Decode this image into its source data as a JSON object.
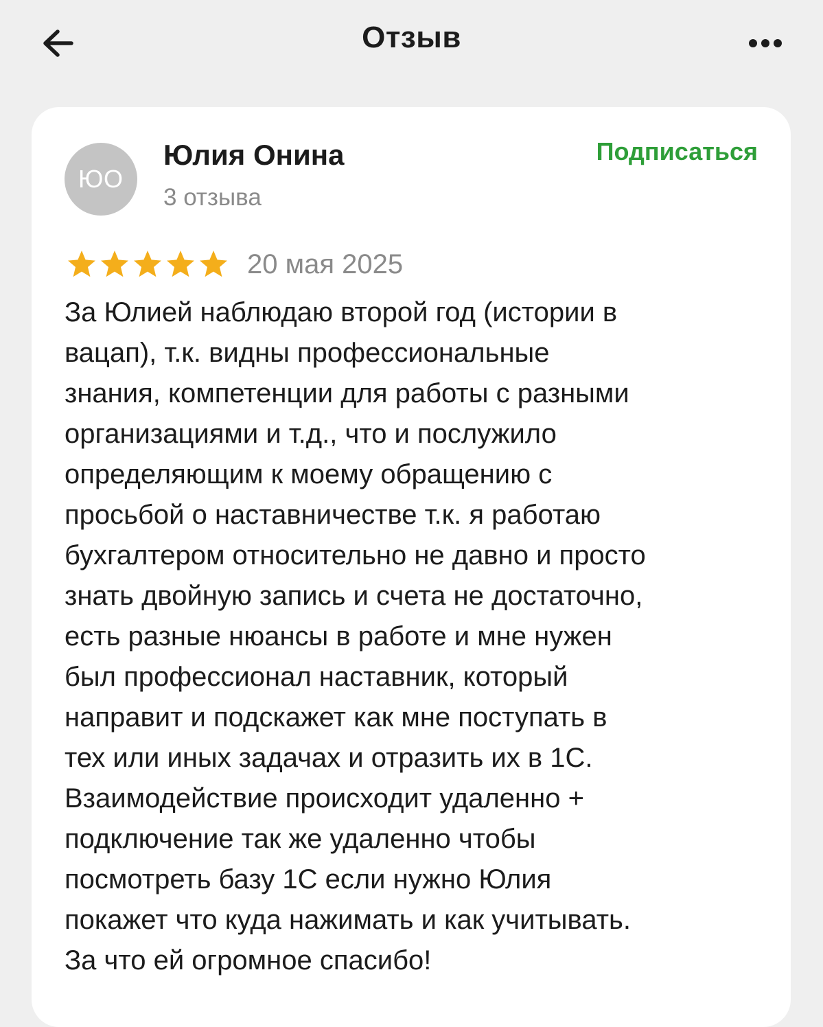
{
  "header": {
    "title": "Отзыв",
    "back_icon": "arrow-left-icon",
    "more_icon": "more-horizontal-icon"
  },
  "review": {
    "author": {
      "initials": "ЮО",
      "name": "Юлия Онина",
      "reviews_count": "3 отзыва"
    },
    "subscribe_label": "Подписаться",
    "rating": 5,
    "rating_max": 5,
    "date": "20 мая 2025",
    "text": "За Юлией наблюдаю второй год (истории в\nвацап), т.к. видны профессиональные\nзнания, компетенции для работы с разными\nорганизациями и т.д., что и послужило\nопределяющим к моему обращению с\nпросьбой о наставничестве т.к. я работаю\nбухгалтером относительно не давно и просто\nзнать двойную запись и счета не достаточно,\nесть разные нюансы в работе и мне нужен\nбыл профессионал наставник, который\nнаправит и подскажет как мне поступать в\nтех или иных задачах и отразить их в 1С.\nВзаимодействие происходит удаленно +\nподключение так же удаленно чтобы\nпосмотреть базу 1С если нужно Юлия\nпокажет что куда нажимать и как учитывать.\nЗа что ей огромное спасибо!"
  },
  "colors": {
    "background": "#efefef",
    "card": "#ffffff",
    "accent_green": "#2e9e38",
    "star": "#f4ae1b",
    "muted_text": "#8a8a8a",
    "avatar_bg": "#c4c4c4"
  }
}
